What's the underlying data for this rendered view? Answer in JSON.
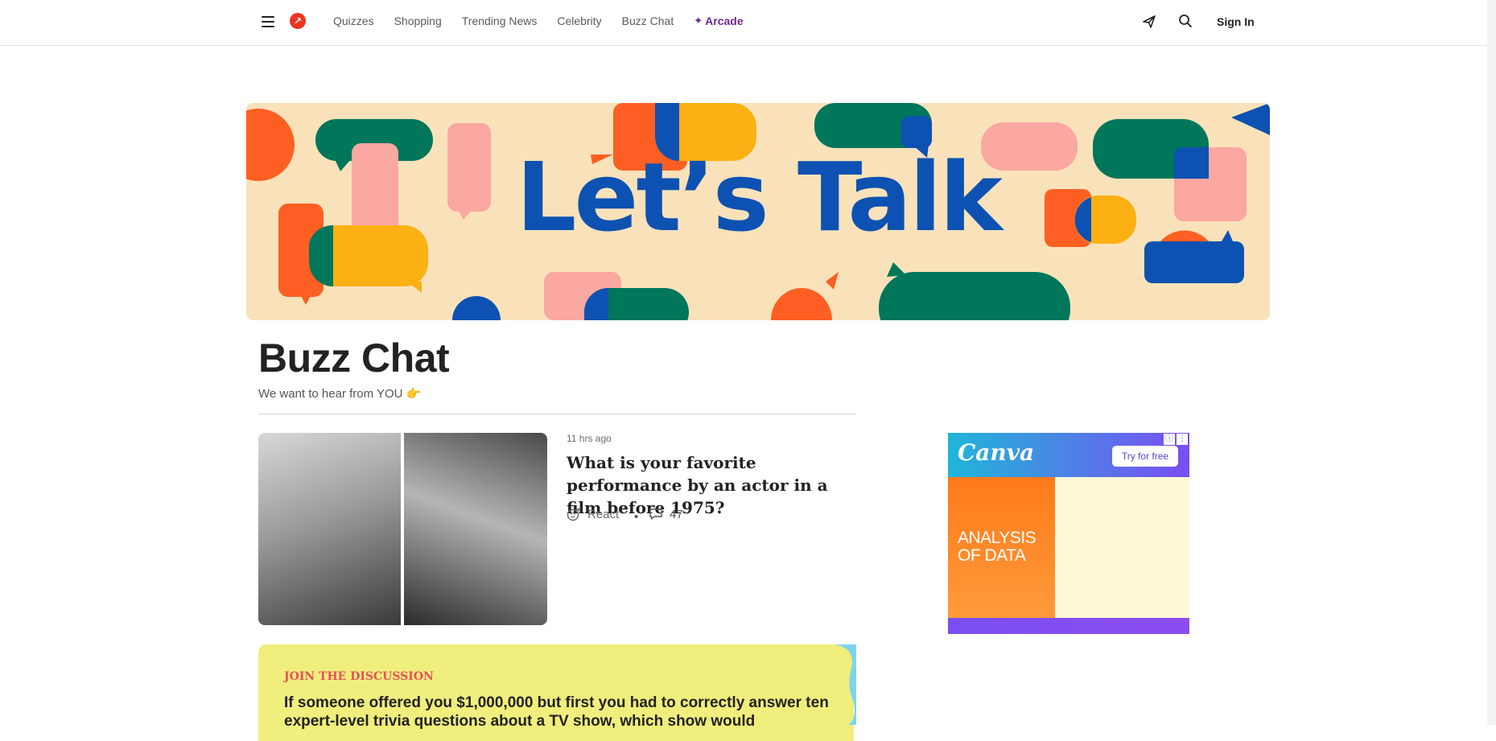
{
  "nav": {
    "items": [
      "Quizzes",
      "Shopping",
      "Trending News",
      "Celebrity",
      "Buzz Chat"
    ],
    "arcade_label": "Arcade",
    "signin_label": "Sign In"
  },
  "banner": {
    "text": "Let’s Talk"
  },
  "page": {
    "title": "Buzz Chat",
    "subtitle": "We want to hear from YOU"
  },
  "post": {
    "time": "11 hrs ago",
    "title": "What is your favorite performance by an actor in a film before 1975?",
    "react_label": "React",
    "comment_count": "47"
  },
  "discussion": {
    "label": "JOIN THE DISCUSSION",
    "question": "If someone offered you $1,000,000 but first you had to correctly answer ten expert-level trivia questions about a TV show, which show would"
  },
  "ad": {
    "brand": "Canva",
    "cta": "Try for free",
    "headline": "ANALYSIS OF DATA"
  }
}
